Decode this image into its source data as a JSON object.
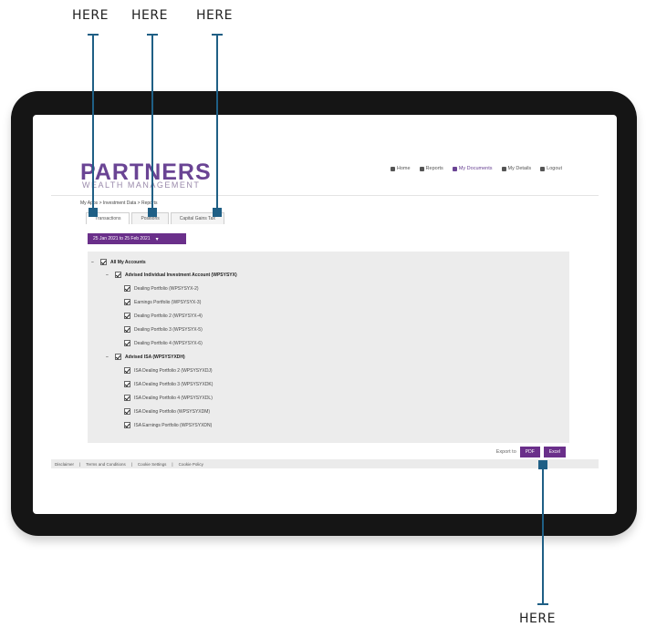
{
  "callouts": {
    "top": [
      "HERE",
      "HERE",
      "HERE"
    ],
    "bottom": "HERE",
    "color": "#1f5f85"
  },
  "brand": {
    "name": "PARTNERS",
    "tagline": "WEALTH MANAGEMENT",
    "color": "#6a4494"
  },
  "topnav": [
    {
      "label": "Home",
      "icon": "home-icon"
    },
    {
      "label": "Reports",
      "icon": "reports-icon"
    },
    {
      "label": "My Documents",
      "icon": "documents-icon"
    },
    {
      "label": "My Details",
      "icon": "user-icon"
    },
    {
      "label": "Logout",
      "icon": "logout-icon"
    }
  ],
  "breadcrumb": "My Apps > Investment Data > Reports",
  "tabs": [
    "Transactions",
    "Positions",
    "Capital Gains Tax"
  ],
  "date_range": "25 Jan 2021 to 25 Feb 2021",
  "tree": {
    "root": "All My Accounts",
    "groups": [
      {
        "label": "Advised Individual Investment Account (WPSYSYX)",
        "items": [
          "Dealing Portfolio (WPSYSYX-2)",
          "Earnings Portfolio (WPSYSYX-3)",
          "Dealing Portfolio 2 (WPSYSYX-4)",
          "Dealing Portfolio 3 (WPSYSYX-5)",
          "Dealing Portfolio 4 (WPSYSYX-6)"
        ]
      },
      {
        "label": "Advised ISA (WPSYSYXDH)",
        "items": [
          "ISA Dealing Portfolio 2 (WPSYSYXDJ)",
          "ISA Dealing Portfolio 3 (WPSYSYXDK)",
          "ISA Dealing Portfolio 4 (WPSYSYXDL)",
          "ISA Dealing Portfolio (WPSYSYXDM)",
          "ISA Earnings Portfolio (WPSYSYXDN)"
        ]
      }
    ]
  },
  "export": {
    "label": "Export to",
    "pdf": "PDF",
    "excel": "Excel"
  },
  "footer": [
    "Disclaimer",
    "Terms and Conditions",
    "Cookie Settings",
    "Cookie Policy"
  ],
  "accent_color": "#6a2f8a"
}
